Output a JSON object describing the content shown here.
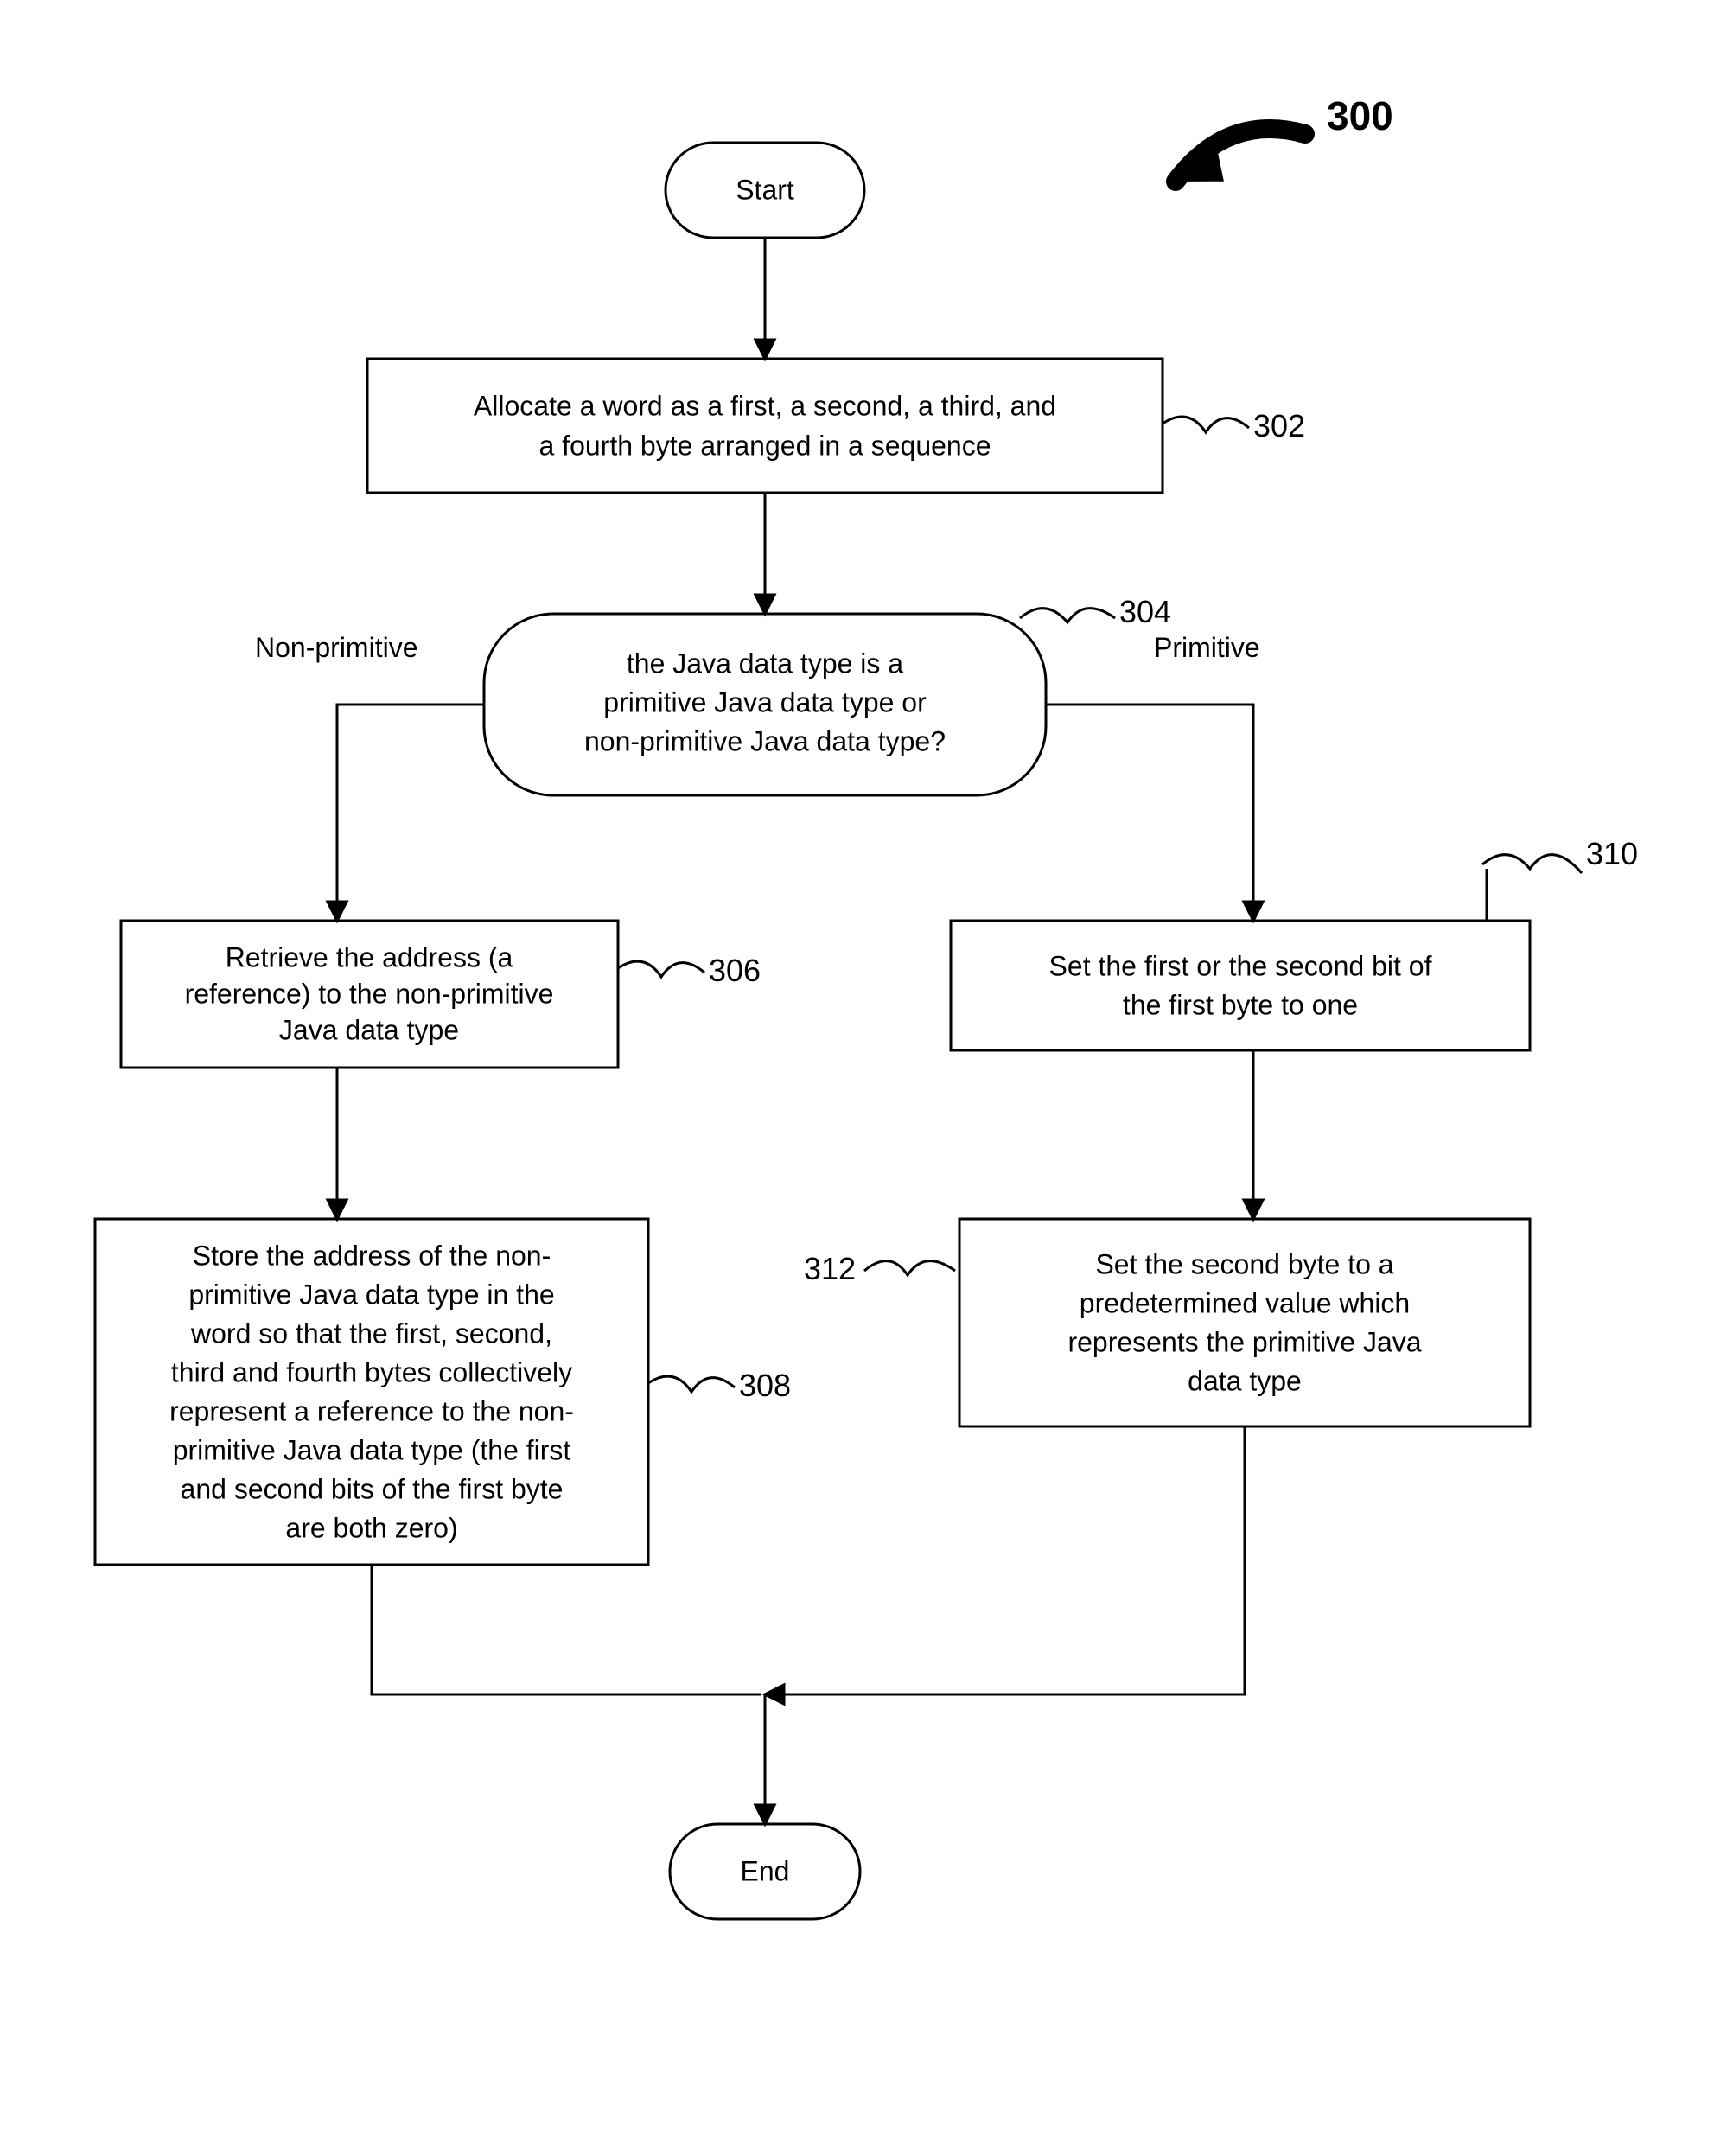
{
  "diagram": {
    "figureRef": "300",
    "start": "Start",
    "end": "End",
    "step302": {
      "line1": "Allocate a word as a first, a second, a third, and",
      "line2": "a fourth byte arranged in a sequence",
      "ref": "302"
    },
    "decision304": {
      "line1": "the Java data type is a",
      "line2": "primitive Java data type or",
      "line3": "non-primitive Java data type?",
      "ref": "304",
      "leftLabel": "Non-primitive",
      "rightLabel": "Primitive"
    },
    "step306": {
      "line1": "Retrieve the address (a",
      "line2": "reference) to the non-primitive",
      "line3": "Java data type",
      "ref": "306"
    },
    "step308": {
      "line1": "Store the address of the non-",
      "line2": "primitive Java data type in the",
      "line3": "word so that the first, second,",
      "line4": "third and fourth bytes collectively",
      "line5": "represent a reference to the non-",
      "line6": "primitive Java data type (the first",
      "line7": "and second bits of the first byte",
      "line8": "are both zero)",
      "ref": "308"
    },
    "step310": {
      "line1": "Set the first or the second bit of",
      "line2": "the first byte to one",
      "ref": "310"
    },
    "step312": {
      "line1": "Set the second byte to a",
      "line2": "predetermined value which",
      "line3": "represents the primitive Java",
      "line4": "data type",
      "ref": "312"
    }
  }
}
